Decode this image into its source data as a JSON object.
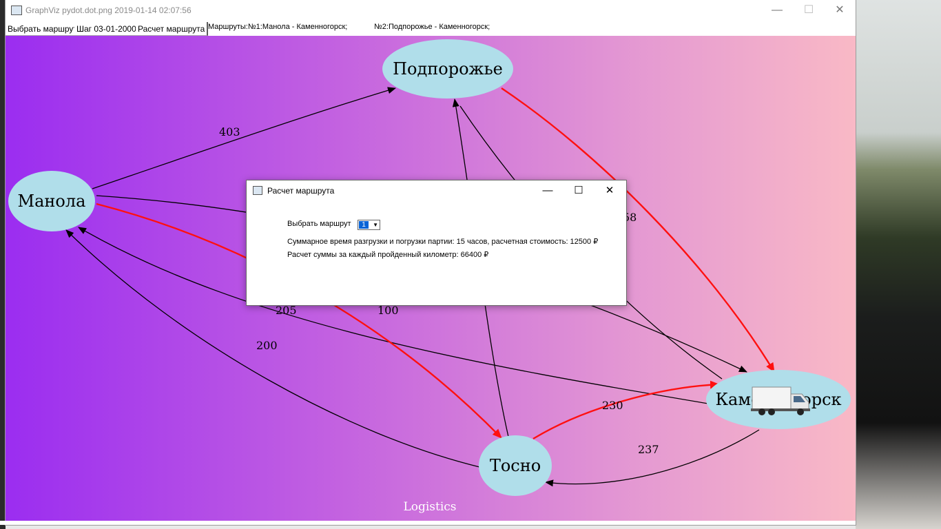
{
  "window": {
    "title": "GraphViz pydot.dot.png 2019-01-14 02:07:56",
    "minimize_glyph": "—",
    "maximize_glyph": "☐",
    "close_glyph": "✕"
  },
  "toolbar": {
    "select_route_button": "Выбрать маршрут",
    "step_button": "Шаг 03-01-2000",
    "calc_route_button": "Расчет маршрута",
    "routes_label": "Маршруты:№1:Манола - Каменногорск;",
    "route2_label": "№2:Подпорожье - Каменногорск;"
  },
  "graph": {
    "nodes": {
      "podporozhye": "Подпорожье",
      "manola": "Манола",
      "tosno": "Тосно",
      "kamennogorsk": "Каменногорск"
    },
    "edge_labels": {
      "manola_podporozhye": "403",
      "manola_tosno_205": "205",
      "tosno_manola_200": "200",
      "label_100": "100",
      "label_58": "58",
      "tosno_kam_230": "230",
      "kam_tosno_237": "237"
    },
    "caption": "Logistics",
    "colors": {
      "highlight_edge": "#ff1010",
      "normal_edge": "#000000",
      "node_fill": "#b0deea"
    }
  },
  "dialog": {
    "title": "Расчет маршрута",
    "select_label": "Выбрать маршрут",
    "select_value": "1",
    "summary_line": "Суммарное время разгрузки и погрузки партии:  15 часов, расчетная стоимость:  12500 ₽",
    "km_line": "Расчет суммы за каждый пройденный километр:  66400 ₽",
    "minimize_glyph": "—",
    "maximize_glyph": "☐",
    "close_glyph": "✕"
  },
  "icons": {
    "truck": "truck-icon",
    "app": "app-icon"
  }
}
